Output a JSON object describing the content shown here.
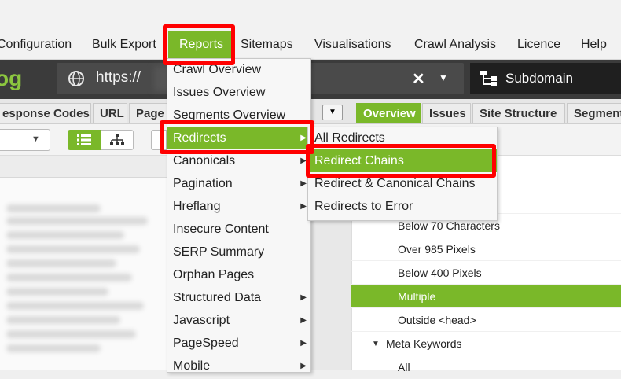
{
  "menubar": {
    "items": [
      "Configuration",
      "Bulk Export",
      "Reports",
      "Sitemaps",
      "Visualisations",
      "Crawl Analysis",
      "Licence",
      "Help"
    ]
  },
  "toolbar": {
    "logo_text": "og",
    "url_value": "https://",
    "clear_icon": "close-icon",
    "dropdown_icon": "chevron-down-icon",
    "globe_icon": "globe-icon",
    "mode_icon": "sitemap-icon",
    "mode_label": "Subdomain"
  },
  "left_tabs": [
    "esponse Codes",
    "URL",
    "Page"
  ],
  "right_tabs": {
    "items": [
      "Overview",
      "Issues",
      "Site Structure",
      "Segment"
    ],
    "active": "Overview"
  },
  "reports_menu": {
    "items": [
      {
        "label": "Crawl Overview",
        "submenu": false
      },
      {
        "label": "Issues Overview",
        "submenu": false
      },
      {
        "label": "Segments Overview",
        "submenu": false
      },
      {
        "label": "Redirects",
        "submenu": true
      },
      {
        "label": "Canonicals",
        "submenu": true
      },
      {
        "label": "Pagination",
        "submenu": true
      },
      {
        "label": "Hreflang",
        "submenu": true
      },
      {
        "label": "Insecure Content",
        "submenu": false
      },
      {
        "label": "SERP Summary",
        "submenu": false
      },
      {
        "label": "Orphan Pages",
        "submenu": false
      },
      {
        "label": "Structured Data",
        "submenu": true
      },
      {
        "label": "Javascript",
        "submenu": true
      },
      {
        "label": "PageSpeed",
        "submenu": true
      },
      {
        "label": "Mobile",
        "submenu": true
      }
    ],
    "highlighted": "Redirects"
  },
  "redirects_submenu": {
    "items": [
      "All Redirects",
      "Redirect Chains",
      "Redirect & Canonical Chains",
      "Redirects to Error"
    ],
    "highlighted": "Redirect Chains"
  },
  "tree": {
    "rows": [
      {
        "label": "ers",
        "selected": false
      },
      {
        "label": "Below 70 Characters",
        "selected": false
      },
      {
        "label": "Over 985 Pixels",
        "selected": false
      },
      {
        "label": "Below 400 Pixels",
        "selected": false
      },
      {
        "label": "Multiple",
        "selected": true
      },
      {
        "label": "Outside <head>",
        "selected": false
      },
      {
        "label": "Meta Keywords",
        "selected": false
      },
      {
        "label": "All",
        "selected": false
      }
    ]
  },
  "colors": {
    "accent": "#7ab829",
    "highlight_box": "#ff0000",
    "toolbar_bg": "#3b3b3b"
  }
}
